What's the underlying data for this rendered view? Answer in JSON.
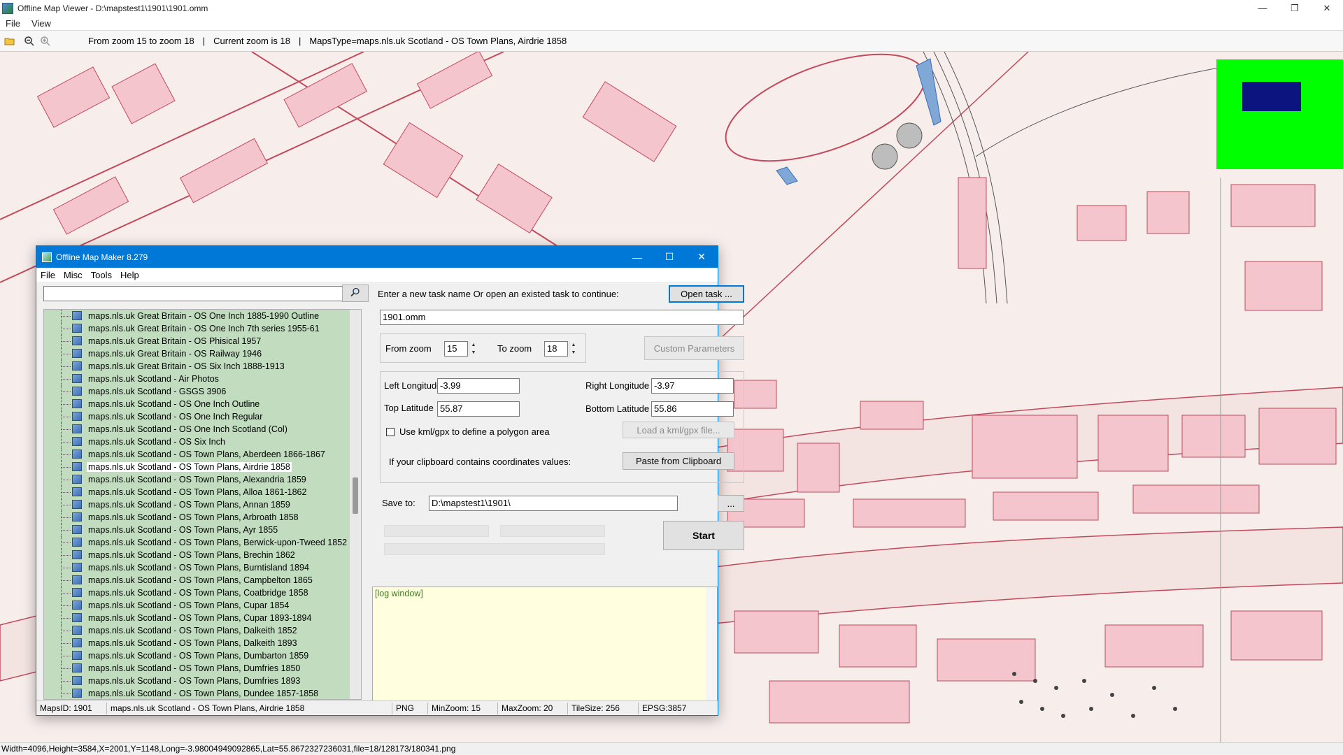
{
  "window": {
    "title": "Offline Map Viewer - D:\\mapstest1\\1901\\1901.omm",
    "minimize": "—",
    "maximize": "❐",
    "close": "✕"
  },
  "menubar": [
    "File",
    "View"
  ],
  "toolbar": {
    "zoom_range": "From zoom 15 to zoom 18",
    "sep1": "|",
    "current_zoom": "Current zoom is 18",
    "sep2": "|",
    "maps_type": "MapsType=maps.nls.uk Scotland - OS Town Plans, Airdrie 1858"
  },
  "statusbar": "Width=4096,Height=3584,X=2001,Y=1148,Long=-3.98004949092865,Lat=55.8672327236031,file=18/128173/180341.png",
  "dialog": {
    "title": "Offline Map Maker 8.279",
    "minimize": "—",
    "maximize": "☐",
    "close": "✕",
    "menu": [
      "File",
      "Misc",
      "Tools",
      "Help"
    ],
    "search_value": "",
    "tree": [
      {
        "label": "maps.nls.uk Great Britain - OS One Inch 1885-1990 Outline",
        "selected": false
      },
      {
        "label": "maps.nls.uk Great Britain - OS One Inch 7th series 1955-61",
        "selected": false
      },
      {
        "label": "maps.nls.uk Great Britain - OS Phisical 1957",
        "selected": false
      },
      {
        "label": "maps.nls.uk Great Britain - OS Railway 1946",
        "selected": false
      },
      {
        "label": "maps.nls.uk Great Britain - OS Six Inch 1888-1913",
        "selected": false
      },
      {
        "label": "maps.nls.uk Scotland - Air Photos",
        "selected": false
      },
      {
        "label": "maps.nls.uk Scotland - GSGS 3906",
        "selected": false
      },
      {
        "label": "maps.nls.uk Scotland - OS One Inch Outline",
        "selected": false
      },
      {
        "label": "maps.nls.uk Scotland - OS One Inch Regular",
        "selected": false
      },
      {
        "label": "maps.nls.uk Scotland - OS One Inch Scotland (Col)",
        "selected": false
      },
      {
        "label": "maps.nls.uk Scotland - OS Six Inch",
        "selected": false
      },
      {
        "label": "maps.nls.uk Scotland - OS Town Plans, Aberdeen 1866-1867",
        "selected": false
      },
      {
        "label": "maps.nls.uk Scotland - OS Town Plans, Airdrie 1858",
        "selected": true
      },
      {
        "label": "maps.nls.uk Scotland - OS Town Plans, Alexandria 1859",
        "selected": false
      },
      {
        "label": "maps.nls.uk Scotland - OS Town Plans, Alloa 1861-1862",
        "selected": false
      },
      {
        "label": "maps.nls.uk Scotland - OS Town Plans, Annan 1859",
        "selected": false
      },
      {
        "label": "maps.nls.uk Scotland - OS Town Plans, Arbroath 1858",
        "selected": false
      },
      {
        "label": "maps.nls.uk Scotland - OS Town Plans, Ayr 1855",
        "selected": false
      },
      {
        "label": "maps.nls.uk Scotland - OS Town Plans, Berwick-upon-Tweed 1852",
        "selected": false
      },
      {
        "label": "maps.nls.uk Scotland - OS Town Plans, Brechin 1862",
        "selected": false
      },
      {
        "label": "maps.nls.uk Scotland - OS Town Plans, Burntisland 1894",
        "selected": false
      },
      {
        "label": "maps.nls.uk Scotland - OS Town Plans, Campbelton 1865",
        "selected": false
      },
      {
        "label": "maps.nls.uk Scotland - OS Town Plans, Coatbridge 1858",
        "selected": false
      },
      {
        "label": "maps.nls.uk Scotland - OS Town Plans, Cupar 1854",
        "selected": false
      },
      {
        "label": "maps.nls.uk Scotland - OS Town Plans, Cupar 1893-1894",
        "selected": false
      },
      {
        "label": "maps.nls.uk Scotland - OS Town Plans, Dalkeith 1852",
        "selected": false
      },
      {
        "label": "maps.nls.uk Scotland - OS Town Plans, Dalkeith 1893",
        "selected": false
      },
      {
        "label": "maps.nls.uk Scotland - OS Town Plans, Dumbarton 1859",
        "selected": false
      },
      {
        "label": "maps.nls.uk Scotland - OS Town Plans, Dumfries 1850",
        "selected": false
      },
      {
        "label": "maps.nls.uk Scotland - OS Town Plans, Dumfries 1893",
        "selected": false
      },
      {
        "label": "maps.nls.uk Scotland - OS Town Plans, Dundee 1857-1858",
        "selected": false
      }
    ],
    "task_prompt": "Enter a new task name Or open an existed task to continue:",
    "open_task": "Open task ...",
    "task_name": "1901.omm",
    "from_zoom_label": "From zoom",
    "from_zoom": "15",
    "to_zoom_label": "To zoom",
    "to_zoom": "18",
    "custom_params": "Custom Parameters",
    "left_lon_label": "Left Longitude",
    "left_lon": "-3.99",
    "right_lon_label": "Right Longitude",
    "right_lon": "-3.97",
    "top_lat_label": "Top Latitude",
    "top_lat": "55.87",
    "bottom_lat_label": "Bottom Latitude",
    "bottom_lat": "55.86",
    "kml_label": "Use kml/gpx to define a polygon area",
    "load_kml": "Load a kml/gpx file...",
    "clipboard_label": "If your clipboard contains coordinates values:",
    "paste_clipboard": "Paste from Clipboard",
    "save_to_label": "Save to:",
    "save_to": "D:\\mapstest1\\1901\\",
    "browse": "...",
    "start": "Start",
    "log": "[log window]",
    "status": {
      "maps_id": "MapsID: 1901",
      "map_name": "maps.nls.uk Scotland - OS Town Plans, Airdrie 1858",
      "format": "PNG",
      "min_zoom": "MinZoom: 15",
      "max_zoom": "MaxZoom: 20",
      "tile_size": "TileSize: 256",
      "epsg": "EPSG:3857"
    }
  },
  "icons": {
    "open": "open-folder-icon",
    "zoom_out": "zoom-out-icon",
    "zoom_in": "zoom-in-icon",
    "search": "search-icon"
  },
  "colors": {
    "map_background": "#f7eeec",
    "building": "#f4c5cd",
    "outline": "#c24a5c",
    "overview_bg": "#00ff00",
    "overview_viewport": "#0c1480",
    "tree_bg": "#c2dcc0",
    "log_bg": "#ffffe0",
    "dialog_title": "#0078d7"
  }
}
